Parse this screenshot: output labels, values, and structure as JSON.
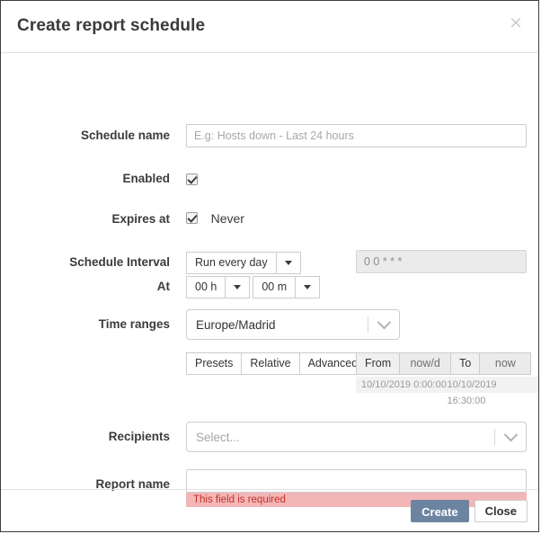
{
  "dialog": {
    "title": "Create report schedule",
    "close_icon": "close-icon",
    "close_glyph": "×"
  },
  "form": {
    "schedule_name": {
      "label": "Schedule name",
      "placeholder": "E.g: Hosts down - Last 24 hours",
      "value": ""
    },
    "enabled": {
      "label": "Enabled",
      "checked": true
    },
    "expires_at": {
      "label": "Expires at",
      "checked": true,
      "option_label": "Never"
    },
    "schedule_interval": {
      "label": "Schedule Interval",
      "selected": "Run every day",
      "cron_value": "0 0 * * *"
    },
    "at": {
      "label": "At",
      "hours": "00 h",
      "minutes": "00 m"
    },
    "time_ranges": {
      "label": "Time ranges",
      "timezone": "Europe/Madrid",
      "mode_buttons": [
        "Presets",
        "Relative",
        "Advanced"
      ],
      "from_label": "From",
      "from_value": "now/d",
      "to_label": "To",
      "to_value": "now",
      "from_resolved": "10/10/2019 0:00:00",
      "to_resolved": "10/10/2019 16:30:00"
    },
    "recipients": {
      "label": "Recipients",
      "placeholder": "Select...",
      "value": ""
    },
    "report_name": {
      "label": "Report name",
      "value": "",
      "error": "This field is required"
    }
  },
  "footer": {
    "create_label": "Create",
    "close_label": "Close"
  },
  "colors": {
    "primary": "#6d84a0",
    "error_bg": "#f3b6b6",
    "error_text": "#c4302b"
  }
}
